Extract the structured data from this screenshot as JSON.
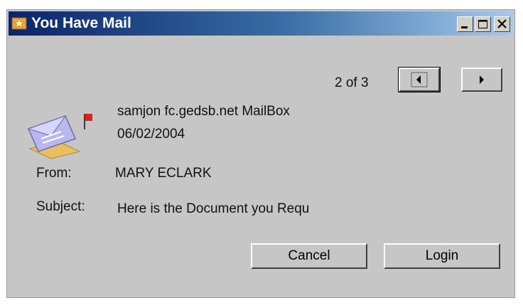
{
  "window": {
    "title": "You Have Mail",
    "title_icon": "mail-star-icon",
    "controls": [
      "minimize-icon",
      "maximize-icon",
      "close-icon"
    ]
  },
  "pager": {
    "text": "2 of 3",
    "prev_icon": "arrow-left-icon",
    "next_icon": "arrow-right-icon"
  },
  "message": {
    "icon": "envelope-flag-icon",
    "mailbox": "samjon fc.gedsb.net MailBox",
    "date": "06/02/2004",
    "from_label": "From:",
    "from_value": "MARY ECLARK",
    "subject_label": "Subject:",
    "subject_value": "Here is the Document you Requ"
  },
  "buttons": {
    "cancel": "Cancel",
    "login": "Login"
  },
  "colors": {
    "titlebar_start": "#0a246a",
    "titlebar_end": "#a6caf0",
    "window_bg": "#c6c6c6",
    "flag": "#e0201a"
  }
}
